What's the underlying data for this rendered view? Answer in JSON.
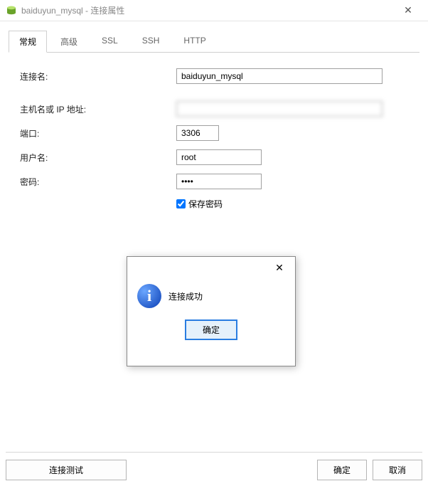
{
  "window": {
    "title": "baiduyun_mysql - 连接属性",
    "close_glyph": "✕"
  },
  "tabs": {
    "general": "常规",
    "advanced": "高级",
    "ssl": "SSL",
    "ssh": "SSH",
    "http": "HTTP"
  },
  "fields": {
    "conn_name": {
      "label": "连接名:",
      "value": "baiduyun_mysql"
    },
    "host": {
      "label": "主机名或 IP 地址:",
      "value": ""
    },
    "port": {
      "label": "端口:",
      "value": "3306"
    },
    "user": {
      "label": "用户名:",
      "value": "root"
    },
    "password": {
      "label": "密码:",
      "value": "••••"
    },
    "save_password": {
      "label": "保存密码",
      "checked": true
    }
  },
  "buttons": {
    "test": "连接测试",
    "ok": "确定",
    "cancel": "取消"
  },
  "popup": {
    "close_glyph": "✕",
    "icon_glyph": "i",
    "message": "连接成功",
    "ok": "确定"
  },
  "watermark": ""
}
